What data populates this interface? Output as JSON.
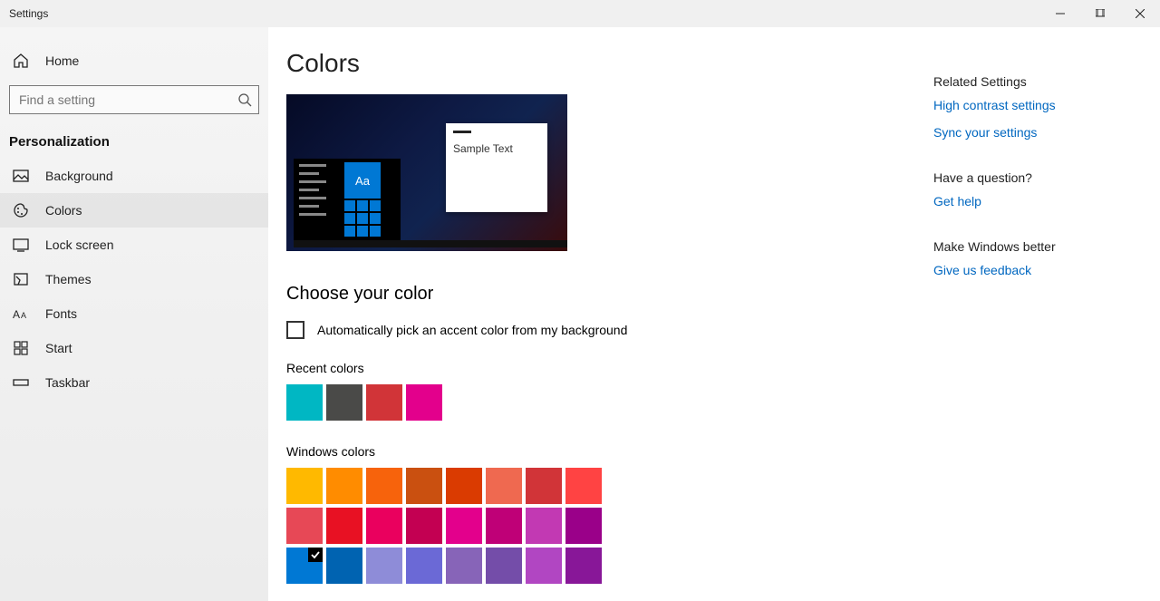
{
  "window": {
    "title": "Settings"
  },
  "sidebar": {
    "home": "Home",
    "search_placeholder": "Find a setting",
    "section": "Personalization",
    "items": [
      {
        "icon": "background",
        "label": "Background"
      },
      {
        "icon": "colors",
        "label": "Colors",
        "active": true
      },
      {
        "icon": "lockscreen",
        "label": "Lock screen"
      },
      {
        "icon": "themes",
        "label": "Themes"
      },
      {
        "icon": "fonts",
        "label": "Fonts"
      },
      {
        "icon": "start",
        "label": "Start"
      },
      {
        "icon": "taskbar",
        "label": "Taskbar"
      }
    ]
  },
  "page": {
    "title": "Colors",
    "preview": {
      "tile_text": "Aa",
      "sample_text": "Sample Text"
    },
    "choose_heading": "Choose your color",
    "auto_pick_label": "Automatically pick an accent color from my background",
    "auto_pick_checked": false,
    "recent_label": "Recent colors",
    "recent_colors": [
      "#00b7c3",
      "#4a4a48",
      "#d13438",
      "#e3008c"
    ],
    "windows_label": "Windows colors",
    "windows_colors": [
      "#ffb900",
      "#ff8c00",
      "#f7630c",
      "#ca5010",
      "#da3b01",
      "#ef6950",
      "#d13438",
      "#ff4343",
      "#e74856",
      "#e81123",
      "#ea005e",
      "#c30052",
      "#e3008c",
      "#bf0077",
      "#c239b3",
      "#9a0089",
      "#0078d4",
      "#0063b1",
      "#8e8cd8",
      "#6b69d6",
      "#8764b8",
      "#744da9",
      "#b146c2",
      "#881798"
    ],
    "selected_color_index": 16
  },
  "aside": {
    "related_heading": "Related Settings",
    "related_links": [
      "High contrast settings",
      "Sync your settings"
    ],
    "question_heading": "Have a question?",
    "question_link": "Get help",
    "feedback_heading": "Make Windows better",
    "feedback_link": "Give us feedback"
  }
}
